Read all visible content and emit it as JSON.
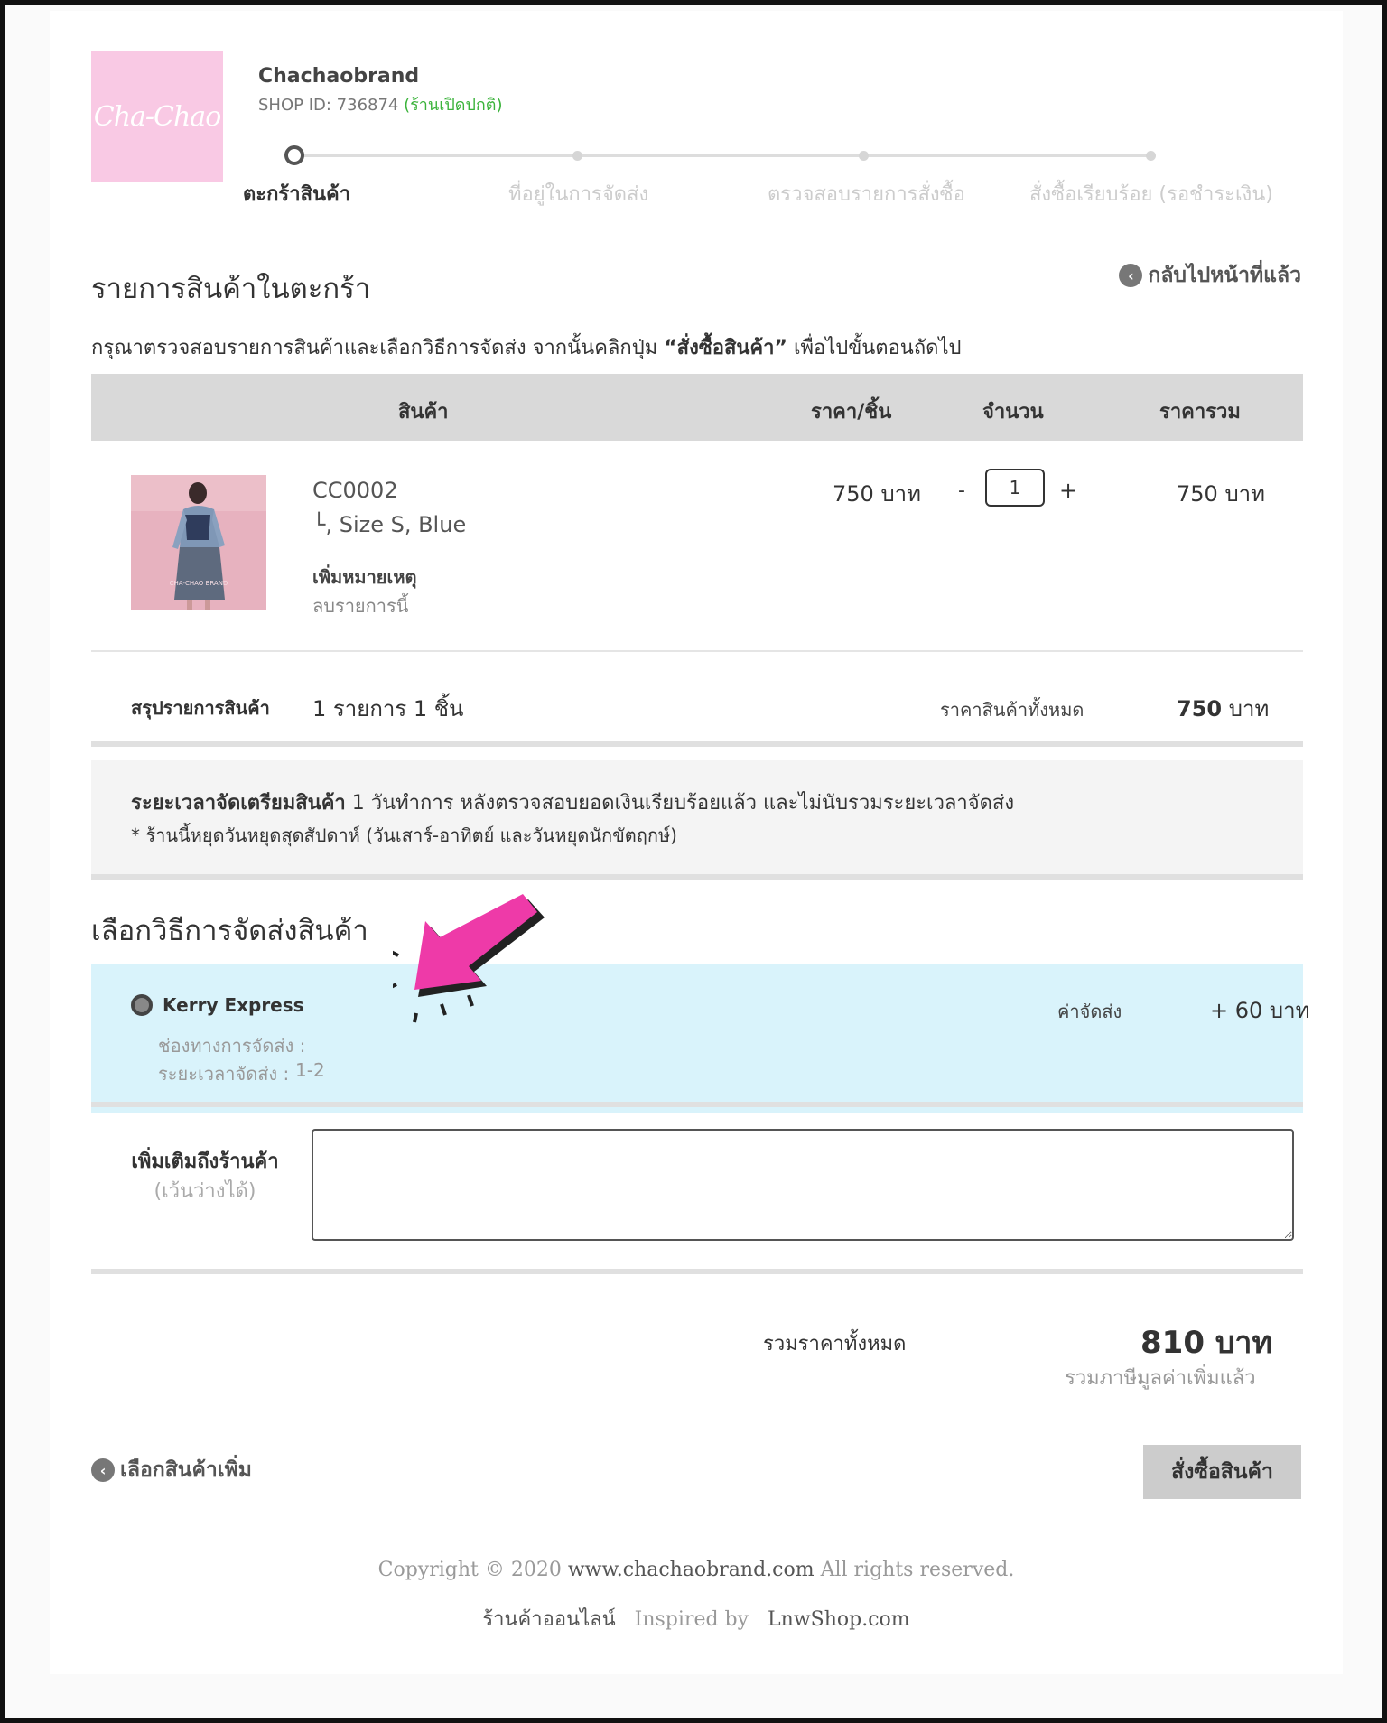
{
  "shop": {
    "logo_text": "Cha-Chao",
    "name": "Chachaobrand",
    "id_text": "SHOP ID: 736874",
    "status": "(ร้านเปิดปกติ)"
  },
  "steps": [
    {
      "label": "ตะกร้าสินค้า",
      "active": true
    },
    {
      "label": "ที่อยู่ในการจัดส่ง",
      "active": false
    },
    {
      "label": "ตรวจสอบรายการสั่งซื้อ",
      "active": false
    },
    {
      "label": "สั่งซื้อเรียบร้อย (รอชำระเงิน)",
      "active": false
    }
  ],
  "cart": {
    "title": "รายการสินค้าในตะกร้า",
    "back_label": "กลับไปหน้าที่แล้ว",
    "instruction_pre": "กรุณาตรวจสอบรายการสินค้าและเลือกวิธีการจัดส่ง จากนั้นคลิกปุ่ม ",
    "instruction_bold": "“สั่งซื้อสินค้า”",
    "instruction_post": " เพื่อไปขั้นตอนถัดไป",
    "columns": {
      "product": "สินค้า",
      "unit_price": "ราคา/ชิ้น",
      "quantity": "จำนวน",
      "total": "ราคารวม"
    },
    "item": {
      "code": "CC0002",
      "variant": "└, Size S, Blue",
      "add_note": "เพิ่มหมายเหตุ",
      "remove": "ลบรายการนี้",
      "unit_price": "750 บาท",
      "qty_minus": "-",
      "quantity": "1",
      "qty_plus": "+",
      "total": "750 บาท",
      "image_caption": "CHA-CHAO BRAND"
    },
    "summary": {
      "label": "สรุปรายการสินค้า",
      "count": "1 รายการ 1 ชิ้น",
      "all_label": "ราคาสินค้าทั้งหมด",
      "total_value": "750",
      "total_unit": " บาท"
    }
  },
  "prep": {
    "bold": "ระยะเวลาจัดเตรียมสินค้า",
    "text": " 1 วันทำการ หลังตรวจสอบยอดเงินเรียบร้อยแล้ว และไม่นับรวมระยะเวลาจัดส่ง",
    "note": "* ร้านนี้หยุดวันหยุดสุดสัปดาห์ (วันเสาร์-อาทิตย์ และวันหยุดนักขัตฤกษ์)"
  },
  "shipping": {
    "title": "เลือกวิธีการจัดส่งสินค้า",
    "option_name": "Kerry Express",
    "channel_label": "ช่องทางการจัดส่ง :",
    "time_label": "ระยะเวลาจัดส่ง :",
    "time_value": "1-2",
    "fee_label": "ค่าจัดส่ง",
    "fee_value": "+ 60 บาท"
  },
  "note_to_shop": {
    "label": "เพิ่มเติมถึงร้านค้า",
    "sub": "(เว้นว่างได้)",
    "value": ""
  },
  "grand": {
    "label": "รวมราคาทั้งหมด",
    "total": "810 บาท",
    "vat": "รวมภาษีมูลค่าเพิ่มแล้ว"
  },
  "actions": {
    "more_products": "เลือกสินค้าเพิ่ม",
    "order": "สั่งซื้อสินค้า"
  },
  "footer": {
    "copyright_pre": "Copyright © 2020 ",
    "site": "www.chachaobrand.com",
    "copyright_post": " All rights reserved.",
    "shop_label": "ร้านค้าออนไลน์",
    "inspired": "Inspired by",
    "platform": "LnwShop.com"
  },
  "colors": {
    "accent_pink": "#f9c9e4",
    "status_green": "#3bb33b",
    "shipping_bg": "#d9f3fb",
    "annotation_arrow": "#ee3aa8"
  }
}
